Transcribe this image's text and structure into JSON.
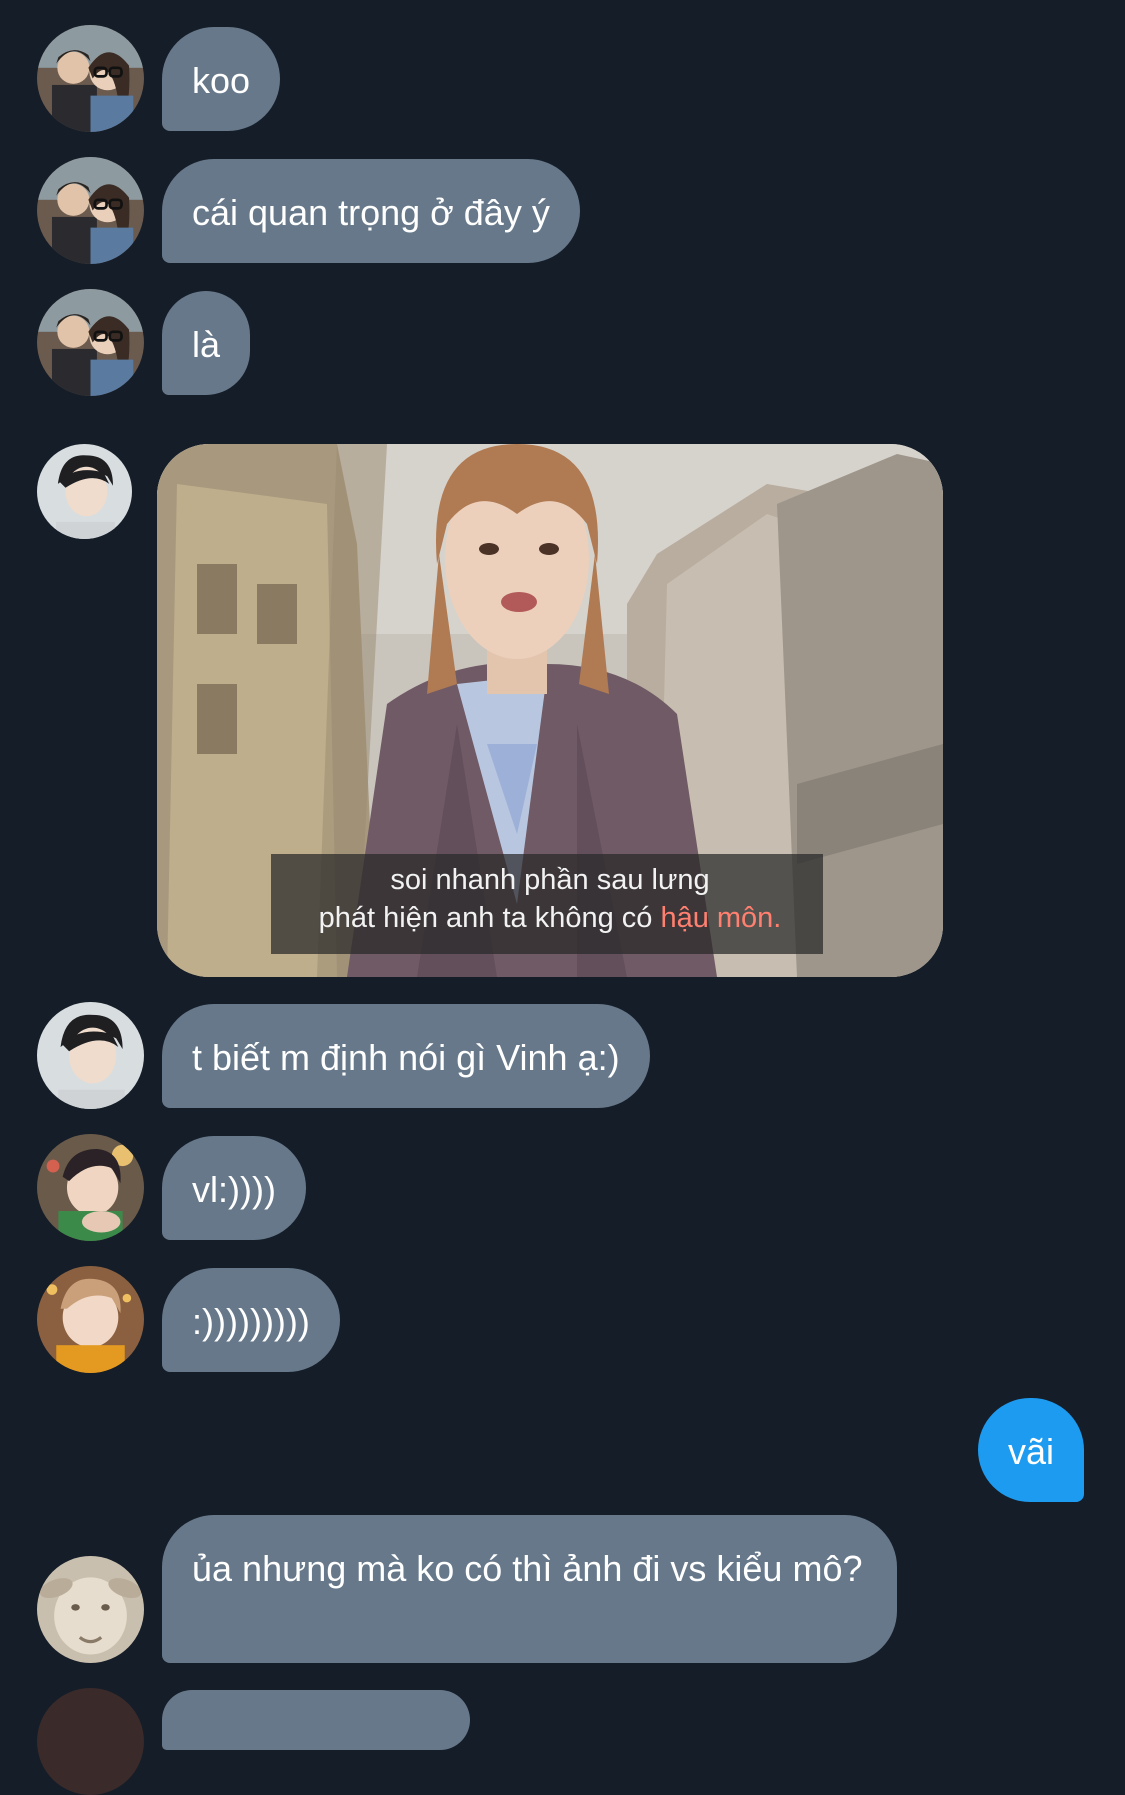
{
  "messages": [
    {
      "sender": "other",
      "type": "text",
      "text": "koo"
    },
    {
      "sender": "other",
      "type": "text",
      "text": "cái quan trọng ở đây ý"
    },
    {
      "sender": "other",
      "type": "text",
      "text": "là"
    },
    {
      "sender": "other",
      "type": "image",
      "subtitle": {
        "line1": "soi nhanh phần sau lưng",
        "line2_pre": "phát hiện anh ta không có ",
        "line2_highlight": "hậu môn."
      }
    },
    {
      "sender": "other",
      "type": "text",
      "text": "t biết m định nói gì Vinh ạ:)"
    },
    {
      "sender": "other",
      "type": "text",
      "text": "vl:))))"
    },
    {
      "sender": "other",
      "type": "text",
      "text": ":)))))))))"
    },
    {
      "sender": "me",
      "type": "text",
      "text": "vãi"
    },
    {
      "sender": "other",
      "type": "text",
      "text": "ủa nhưng mà ko có thì ảnh đi vs kiểu mô?"
    }
  ],
  "colors": {
    "background": "#151d28",
    "incoming_bubble": "#66788a",
    "outgoing_bubble": "#1d9bf0",
    "subtitle_highlight": "#ff8070"
  }
}
